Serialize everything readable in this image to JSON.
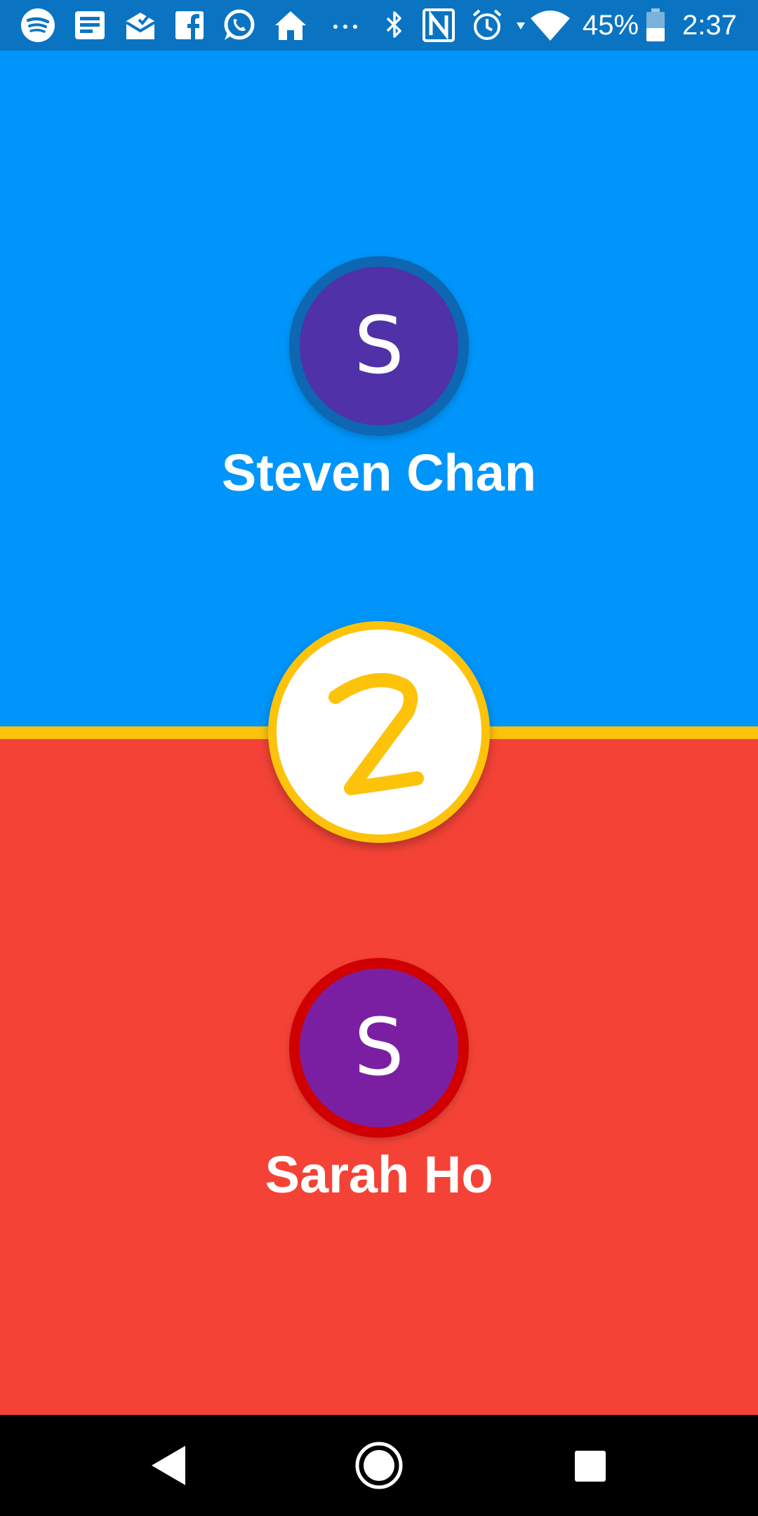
{
  "status_bar": {
    "battery_percent": "45%",
    "time": "2:37",
    "icons": [
      "spotify-icon",
      "news-icon",
      "mail-icon",
      "facebook-icon",
      "whatsapp-icon",
      "home-icon",
      "more-icon",
      "bluetooth-icon",
      "nfc-icon",
      "alarm-icon",
      "wifi-icon",
      "battery-icon"
    ]
  },
  "players": {
    "top": {
      "initial": "S",
      "name": "Steven Chan"
    },
    "bottom": {
      "initial": "S",
      "name": "Sarah Ho"
    }
  },
  "colors": {
    "top_panel": "#0095fa",
    "bottom_panel": "#f44336",
    "accent_yellow": "#fdc30b",
    "status_bar": "#0a74c2"
  },
  "nav_bar": {
    "buttons": [
      "back-icon",
      "home-icon",
      "recents-icon"
    ]
  }
}
